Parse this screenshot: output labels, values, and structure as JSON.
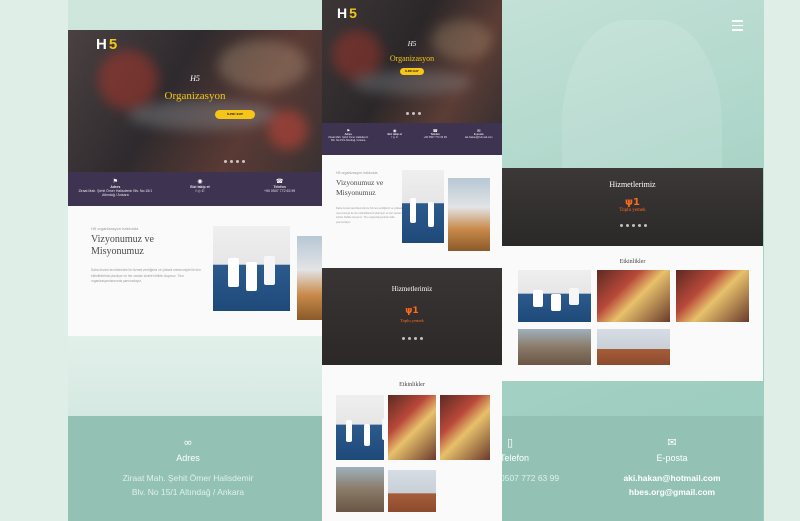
{
  "brand": {
    "logo_letter": "H",
    "logo_number": "5"
  },
  "hero": {
    "small_logo": "H5",
    "title": "Organizasyon",
    "button_label": "İLERİ KAY"
  },
  "info_bar": [
    {
      "icon": "map-marker-icon",
      "title": "Adres",
      "text": "Ziraat Mah. Şehit Ömer Halisdemir Blv. No:15/1 Altındağ / Ankara"
    },
    {
      "icon": "share-icon",
      "title": "Bizi takip et",
      "text": "f  ◎  ✆"
    },
    {
      "icon": "phone-icon",
      "title": "Telefon",
      "text": "+90 0507 772 63 99"
    }
  ],
  "vision": {
    "kicker": "H5 organizasyon hakkında",
    "title_line1": "Vizyonumuz ve",
    "title_line2": "Misyonumuz",
    "body": "Daha önceki tecrübemizle ile hizmet verdiğimiz ve yüksek memnuniyet ile tüm etkinliklerinizi planlıyor ve her zaman sizinle birlikte oluyoruz. Tüm organizasyonlarınızda yanınızdayız."
  },
  "services": {
    "title": "Hizmetlerimiz",
    "item": "Yiyecek Servisi",
    "item_short": "Toplu yemek"
  },
  "events": {
    "title": "Etkinlikler"
  },
  "contact": {
    "address_label": "Adres",
    "address_line1": "Ziraat Mah. Şehit Ömer Halisdemir",
    "address_line2": "Blv. No 15/1 Altındağ / Ankara",
    "phone_label": "Telefon",
    "phone_value": "0507 772 63 99",
    "email_label": "E-posta",
    "email_line1": "aki.hakan@hotmail.com",
    "email_line2": "hbes.org@gmail.com"
  },
  "colors": {
    "accent": "#f5c518",
    "purple": "#3e3350",
    "teal": "#93c2b5",
    "orange": "#ff6a1a"
  }
}
